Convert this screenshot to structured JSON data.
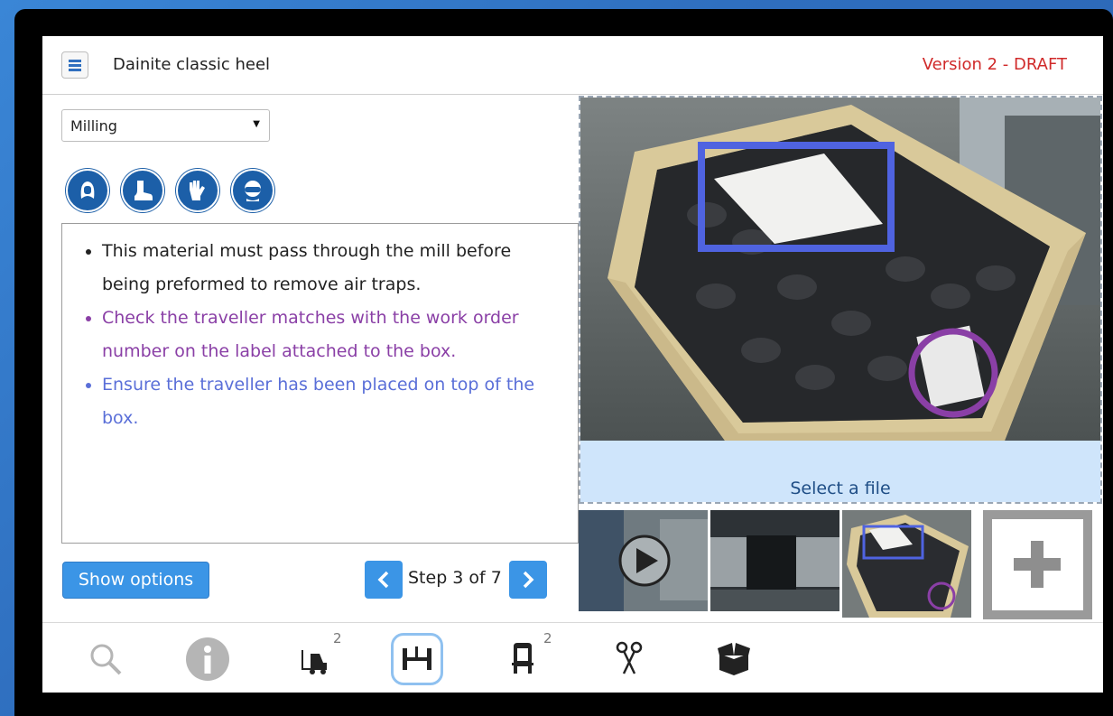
{
  "header": {
    "title": "Dainite classic heel",
    "version": "Version 2 - DRAFT",
    "version_color": "#d02a2a"
  },
  "process_select": {
    "value": "Milling"
  },
  "ppe_icons": [
    "head-protection-icon",
    "safety-boots-icon",
    "gloves-icon",
    "safety-goggles-icon"
  ],
  "instructions": [
    {
      "text": "This material must pass through the mill before being preformed to remove air traps.",
      "color": "#222222"
    },
    {
      "text": "Check the traveller matches with the work order number on the label attached to the box.",
      "color": "#8a3fa6"
    },
    {
      "text": "Ensure the traveller has been placed on top of the box.",
      "color": "#5a6fd8"
    }
  ],
  "footer": {
    "show_options_label": "Show options",
    "step_label": "Step 3 of 7"
  },
  "media": {
    "select_file_label": "Select a file",
    "thumbnails": [
      "video-thumbnail",
      "roller-thumbnail",
      "crate-thumbnail"
    ]
  },
  "toolbar": {
    "items": [
      {
        "icon": "search-icon",
        "badge": ""
      },
      {
        "icon": "info-icon",
        "badge": ""
      },
      {
        "icon": "forklift-icon",
        "badge": "2"
      },
      {
        "icon": "mill-icon",
        "badge": ""
      },
      {
        "icon": "press-icon",
        "badge": "2"
      },
      {
        "icon": "scissors-icon",
        "badge": ""
      },
      {
        "icon": "box-icon",
        "badge": ""
      }
    ]
  }
}
